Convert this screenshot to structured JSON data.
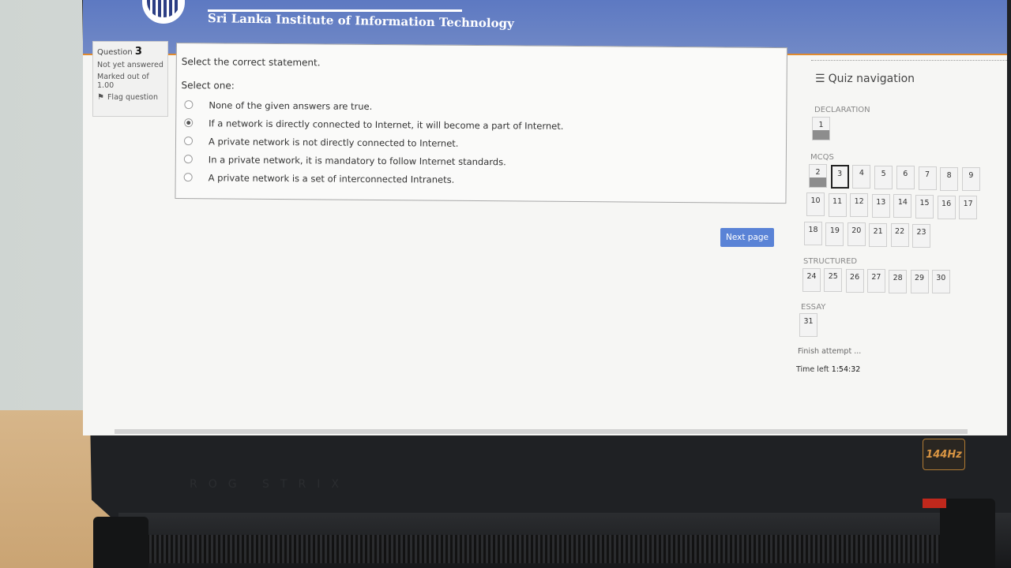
{
  "header": {
    "institution": "Sri Lanka Institute of Information Technology"
  },
  "question_info": {
    "label": "Question",
    "number": "3",
    "status": "Not yet answered",
    "marked_label": "Marked out of",
    "marked_value": "1.00",
    "flag_label": "Flag question"
  },
  "question": {
    "text": "Select the correct statement.",
    "select_one": "Select one:",
    "answers": [
      {
        "label": "None of the given answers are true.",
        "selected": false
      },
      {
        "label": "If a network is directly connected to Internet, it will become a part of Internet.",
        "selected": true
      },
      {
        "label": "A private network is not directly connected to Internet.",
        "selected": false
      },
      {
        "label": "In a private network, it is mandatory to follow Internet standards.",
        "selected": false
      },
      {
        "label": "A private network is a set of interconnected Intranets.",
        "selected": false
      }
    ]
  },
  "next_label": "Next page",
  "quiz_nav": {
    "title": "Quiz navigation",
    "sections": [
      {
        "label": "DECLARATION",
        "items": [
          {
            "n": "1",
            "answered": true
          }
        ]
      },
      {
        "label": "MCQS",
        "items": [
          {
            "n": "2",
            "answered": true
          },
          {
            "n": "3",
            "current": true
          },
          {
            "n": "4"
          },
          {
            "n": "5"
          },
          {
            "n": "6"
          },
          {
            "n": "7"
          },
          {
            "n": "8"
          },
          {
            "n": "9"
          },
          {
            "n": "10"
          },
          {
            "n": "11"
          },
          {
            "n": "12"
          },
          {
            "n": "13"
          },
          {
            "n": "14"
          },
          {
            "n": "15"
          },
          {
            "n": "16"
          },
          {
            "n": "17"
          },
          {
            "n": "18"
          },
          {
            "n": "19"
          },
          {
            "n": "20"
          },
          {
            "n": "21"
          },
          {
            "n": "22"
          },
          {
            "n": "23"
          }
        ]
      },
      {
        "label": "STRUCTURED",
        "items": [
          {
            "n": "24"
          },
          {
            "n": "25"
          },
          {
            "n": "26"
          },
          {
            "n": "27"
          },
          {
            "n": "28"
          },
          {
            "n": "29"
          },
          {
            "n": "30"
          }
        ]
      },
      {
        "label": "ESSAY",
        "items": [
          {
            "n": "31"
          }
        ]
      }
    ],
    "finish_label": "Finish attempt ...",
    "time_label": "Time left",
    "time_value": "1:54:32"
  },
  "hardware": {
    "refresh_badge": "144Hz",
    "brand": "ROG STRIX"
  }
}
